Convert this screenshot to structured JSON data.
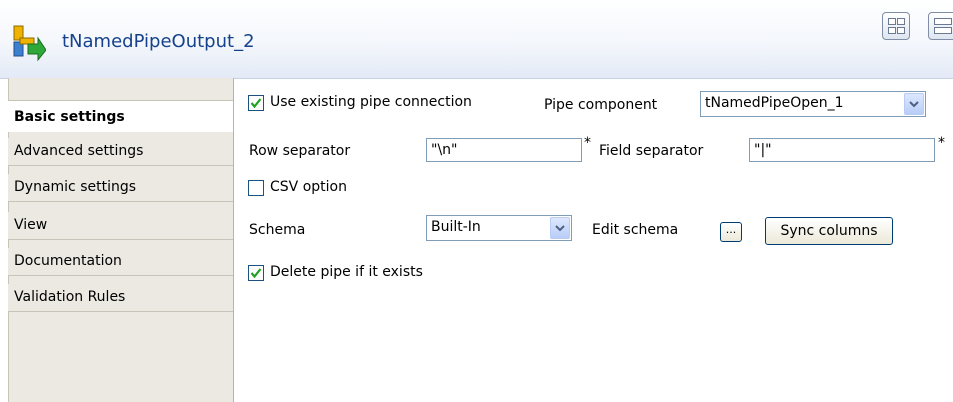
{
  "header": {
    "title": "tNamedPipeOutput_2",
    "icon": "component-output-icon",
    "view_buttons": [
      "grid-view-icon",
      "list-view-icon"
    ]
  },
  "sidebar": {
    "items": [
      {
        "label": "Basic settings",
        "active": true
      },
      {
        "label": "Advanced settings",
        "active": false
      },
      {
        "label": "Dynamic settings",
        "active": false
      },
      {
        "label": "View",
        "active": false
      },
      {
        "label": "Documentation",
        "active": false
      },
      {
        "label": "Validation Rules",
        "active": false
      }
    ]
  },
  "form": {
    "use_existing": {
      "label": "Use existing pipe connection",
      "checked": true
    },
    "pipe_component": {
      "label": "Pipe component",
      "value": "tNamedPipeOpen_1"
    },
    "row_separator": {
      "label": "Row separator",
      "value": "\"\\n\"",
      "required": "*"
    },
    "field_separator": {
      "label": "Field separator",
      "value": "\"|\"",
      "required": "*"
    },
    "csv_option": {
      "label": "CSV option",
      "checked": false
    },
    "schema": {
      "label": "Schema",
      "value": "Built-In"
    },
    "edit_schema": {
      "label": "Edit schema",
      "button": "..."
    },
    "sync_columns": {
      "label": "Sync columns"
    },
    "delete_pipe": {
      "label": "Delete pipe if it exists",
      "checked": true
    }
  },
  "colors": {
    "title": "#15428b",
    "checkbox_tick": "#21a121",
    "sidebar_bg": "#ebe9e2"
  }
}
